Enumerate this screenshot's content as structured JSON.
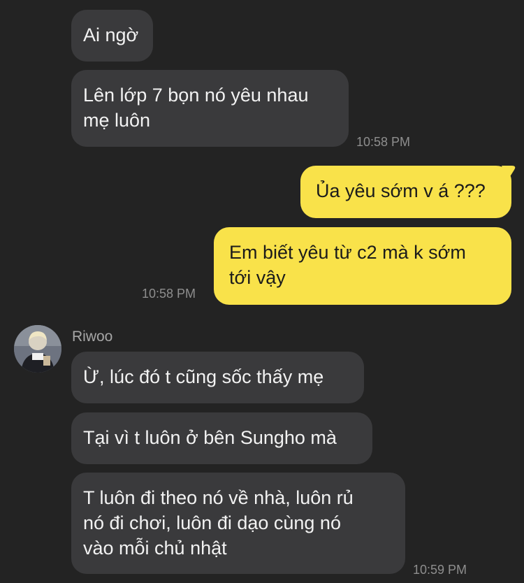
{
  "messages": [
    {
      "text": "Ai ngờ"
    },
    {
      "text": "Lên lớp 7 bọn nó yêu nhau\nmẹ luôn"
    },
    {
      "text": "Ủa yêu sớm v á ???"
    },
    {
      "text": "Em biết yêu từ c2 mà k sớm\ntới vậy"
    },
    {
      "text": "Ừ, lúc đó t cũng sốc thấy mẹ"
    },
    {
      "text": "Tại vì t luôn ở bên Sungho mà"
    },
    {
      "text": "T luôn đi theo nó về nhà, luôn rủ\nnó đi chơi, luôn đi dạo cùng nó\nvào mỗi chủ nhật"
    }
  ],
  "times": [
    "10:58 PM",
    "10:58 PM",
    "10:59 PM"
  ],
  "sender": {
    "name": "Riwoo",
    "avatar_icon": "profile-avatar"
  },
  "colors": {
    "background": "#232323",
    "incoming_bubble": "#3a3a3c",
    "outgoing_bubble": "#f9e24a",
    "timestamp": "#8e8e8e"
  }
}
